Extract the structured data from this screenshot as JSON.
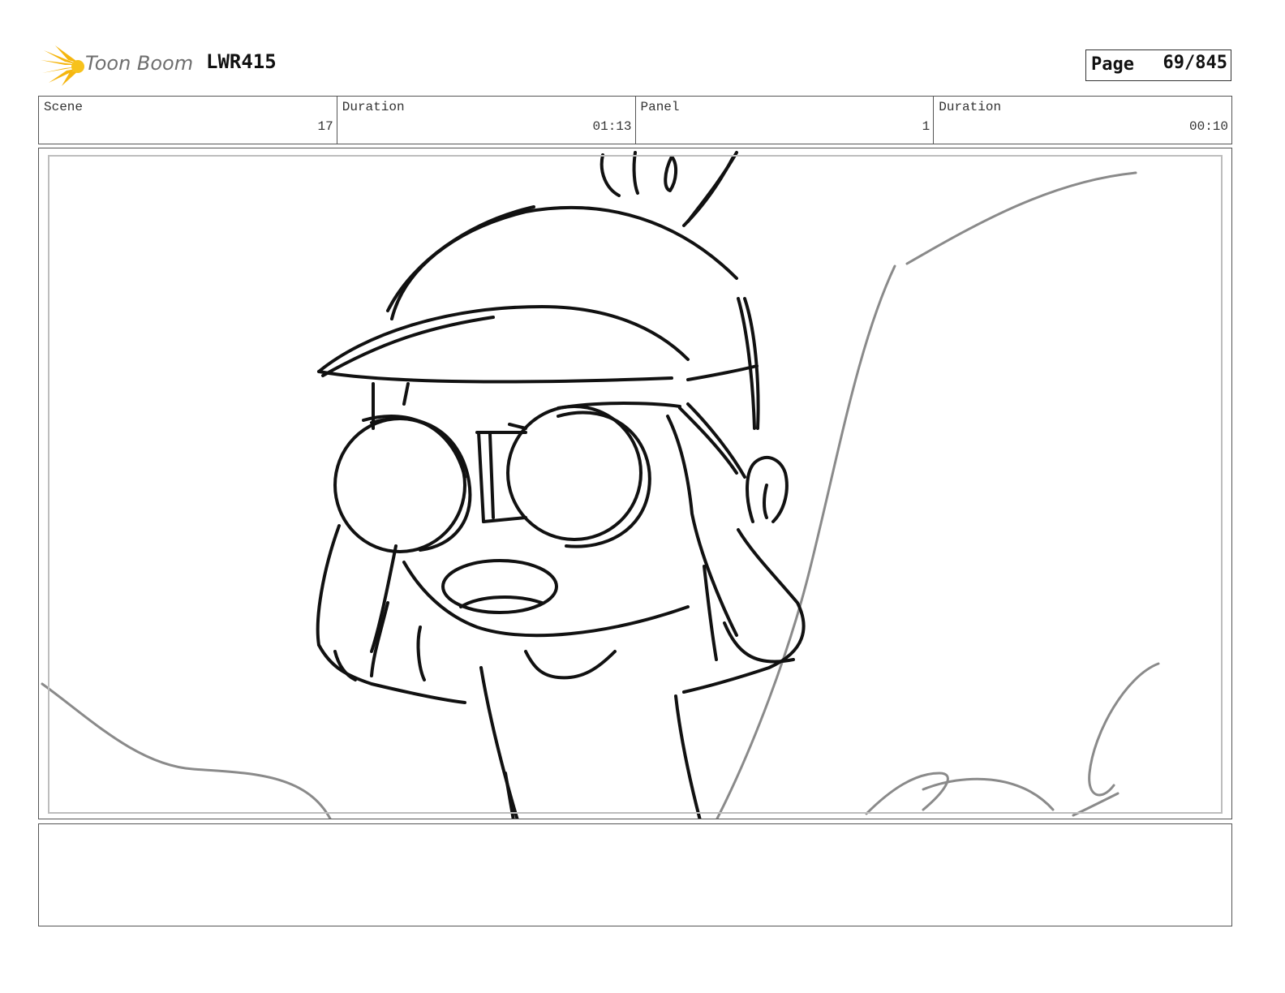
{
  "header": {
    "logo_text": "Toon Boom",
    "project_code": "LWR415",
    "page_label": "Page",
    "page_value": "69/845"
  },
  "info": {
    "scene_label": "Scene",
    "scene_value": "17",
    "scene_duration_label": "Duration",
    "scene_duration_value": "01:13",
    "panel_label": "Panel",
    "panel_value": "1",
    "panel_duration_label": "Duration",
    "panel_duration_value": "00:10"
  },
  "panel": {
    "image": "storyboard-sketch: character with cap looking through binoculars, rock edge at right"
  },
  "notes": {
    "text": ""
  },
  "colors": {
    "logo_accent": "#f5b60f",
    "logo_text": "#6e6e6e",
    "border": "#555555",
    "sketch_line": "#111111",
    "background_sketch": "#8a8a8a"
  }
}
